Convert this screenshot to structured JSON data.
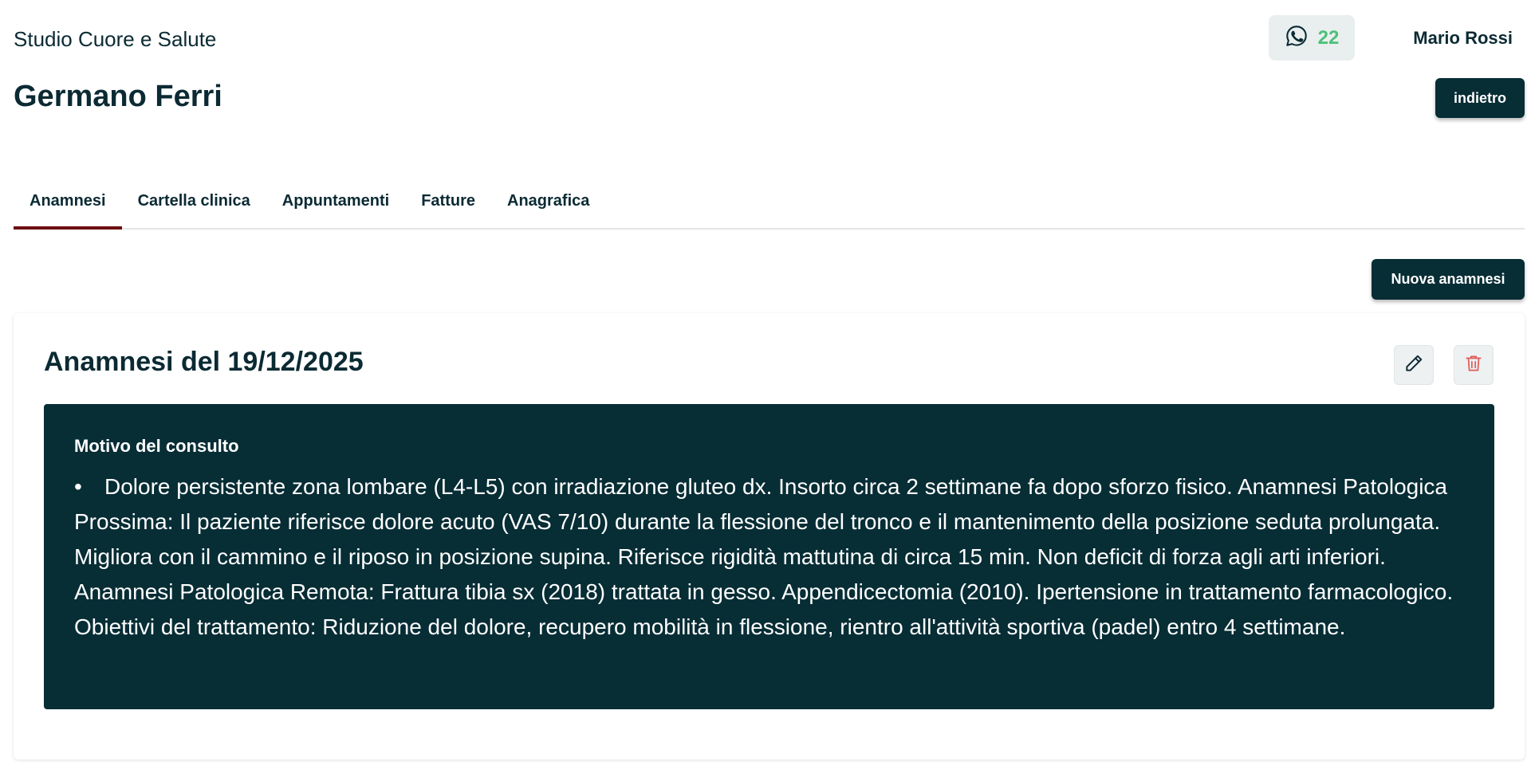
{
  "header": {
    "studio_name": "Studio Cuore e Salute",
    "whatsapp_count": "22",
    "user_name": "Mario Rossi"
  },
  "patient": {
    "name": "Germano Ferri",
    "back_label": "indietro"
  },
  "tabs": [
    {
      "label": "Anamnesi",
      "active": true
    },
    {
      "label": "Cartella clinica",
      "active": false
    },
    {
      "label": "Appuntamenti",
      "active": false
    },
    {
      "label": "Fatture",
      "active": false
    },
    {
      "label": "Anagrafica",
      "active": false
    }
  ],
  "actions": {
    "new_label": "Nuova anamnesi"
  },
  "anamnesi": {
    "title": "Anamnesi del 19/12/2025",
    "section_label": "Motivo del consulto",
    "bullet": "•",
    "text": "Dolore persistente zona lombare (L4-L5) con irradiazione gluteo dx. Insorto circa 2 settimane fa dopo sforzo fisico. Anamnesi Patologica Prossima: Il paziente riferisce dolore acuto (VAS 7/10) durante la flessione del tronco e il mantenimento della posizione seduta prolungata. Migliora con il cammino e il riposo in posizione supina. Riferisce rigidità mattutina di circa 15 min. Non deficit di forza agli arti inferiori. Anamnesi Patologica Remota: Frattura tibia sx (2018) trattata in gesso. Appendicectomia (2010). Ipertensione in trattamento farmacologico. Obiettivi del trattamento: Riduzione del dolore, recupero mobilità in flessione, rientro all'attività sportiva (padel) entro 4 settimane."
  },
  "icons": {
    "whatsapp": "whatsapp-icon",
    "edit": "pencil-icon",
    "delete": "trash-icon"
  },
  "colors": {
    "primary": "#072d35",
    "tab_active_underline": "#6b0f0f",
    "whatsapp_count": "#4cc07a",
    "delete_icon": "#e05a5a"
  }
}
